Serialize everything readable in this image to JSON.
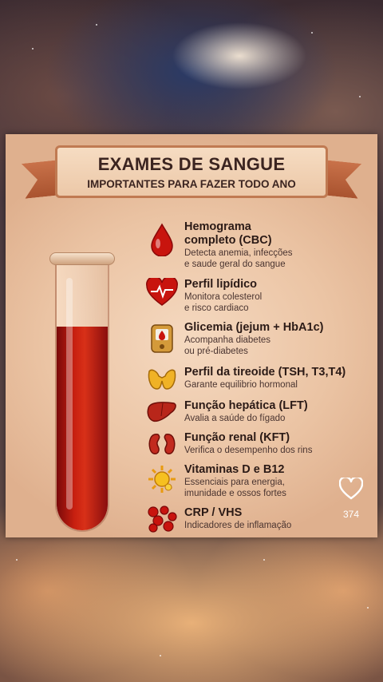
{
  "poster": {
    "title": "EXAMES DE SANGUE",
    "subtitle": "IMPORTANTES PARA FAZER TODO ANO",
    "items": [
      {
        "icon": "blood-drop-icon",
        "title_line1": "Hemograma",
        "title_line2": "completo (CBC)",
        "desc_line1": "Detecta anemia, infecções",
        "desc_line2": "e saude geral do sangue"
      },
      {
        "icon": "heart-icon",
        "title_line1": "Perfil lipídico",
        "title_line2": "",
        "desc_line1": "Monitora colesterol",
        "desc_line2": "e risco cardiaco"
      },
      {
        "icon": "glucometer-icon",
        "title_line1": "Glicemia (jejum + HbA1c)",
        "title_line2": "",
        "desc_line1": "Acompanha diabetes",
        "desc_line2": "ou pré-diabetes"
      },
      {
        "icon": "thyroid-icon",
        "title_line1": "Perfil da tireoide (TSH, T3,T4)",
        "title_line2": "",
        "desc_line1": "Garante equilibrio hormonal",
        "desc_line2": ""
      },
      {
        "icon": "liver-icon",
        "title_line1": "Função hepática (LFT)",
        "title_line2": "",
        "desc_line1": "Avalia a saúde do fígado",
        "desc_line2": ""
      },
      {
        "icon": "kidneys-icon",
        "title_line1": "Função renal (KFT)",
        "title_line2": "",
        "desc_line1": "Verifica o desempenho dos rins",
        "desc_line2": ""
      },
      {
        "icon": "sun-vitamin-icon",
        "title_line1": "Vitaminas D e B12",
        "title_line2": "",
        "desc_line1": "Essenciais para energia,",
        "desc_line2": "imunidade e ossos fortes"
      },
      {
        "icon": "blood-cells-icon",
        "title_line1": "CRP / VHS",
        "title_line2": "",
        "desc_line1": "Indicadores de inflamação",
        "desc_line2": ""
      }
    ]
  },
  "like": {
    "icon": "heart-outline-icon",
    "count": "374"
  },
  "colors": {
    "accent": "#c82010",
    "ribbon": "#c07a52",
    "text": "#2b1a16"
  }
}
